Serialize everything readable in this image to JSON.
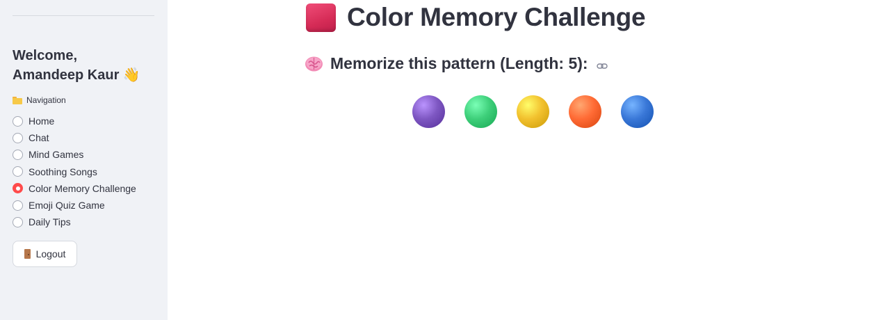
{
  "sidebar": {
    "welcome_line1": "Welcome,",
    "welcome_line2": "Amandeep Kaur 👋",
    "navigation_label": "Navigation",
    "nav_items": [
      {
        "label": "Home",
        "selected": false
      },
      {
        "label": "Chat",
        "selected": false
      },
      {
        "label": "Mind Games",
        "selected": false
      },
      {
        "label": "Soothing Songs",
        "selected": false
      },
      {
        "label": "Color Memory Challenge",
        "selected": true
      },
      {
        "label": "Emoji Quiz Game",
        "selected": false
      },
      {
        "label": "Daily Tips",
        "selected": false
      }
    ],
    "logout_label": "Logout"
  },
  "main": {
    "title": "Color Memory Challenge",
    "subtitle": "Memorize this pattern (Length: 5):",
    "pattern_colors": [
      {
        "name": "purple",
        "color": "#7e57c2"
      },
      {
        "name": "green",
        "color": "#3ecf7a"
      },
      {
        "name": "yellow",
        "color": "#f2c12e"
      },
      {
        "name": "orange",
        "color": "#ff6b35"
      },
      {
        "name": "blue",
        "color": "#3a78d8"
      }
    ]
  },
  "colors": {
    "accent": "#ff4b4b",
    "sidebar_bg": "#f0f2f6",
    "text": "#31333f"
  }
}
